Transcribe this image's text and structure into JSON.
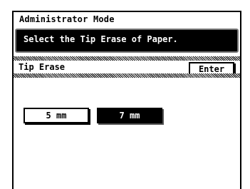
{
  "header": {
    "mode_title": "Administrator Mode"
  },
  "message": {
    "text": "Select the Tip Erase of Paper."
  },
  "section": {
    "label": "Tip Erase",
    "enter_label": "Enter"
  },
  "options": [
    {
      "label": "5 mm",
      "selected": false
    },
    {
      "label": "7 mm",
      "selected": true
    }
  ],
  "colors": {
    "background": "#ffffff",
    "foreground": "#000000",
    "selected": "#000000"
  }
}
